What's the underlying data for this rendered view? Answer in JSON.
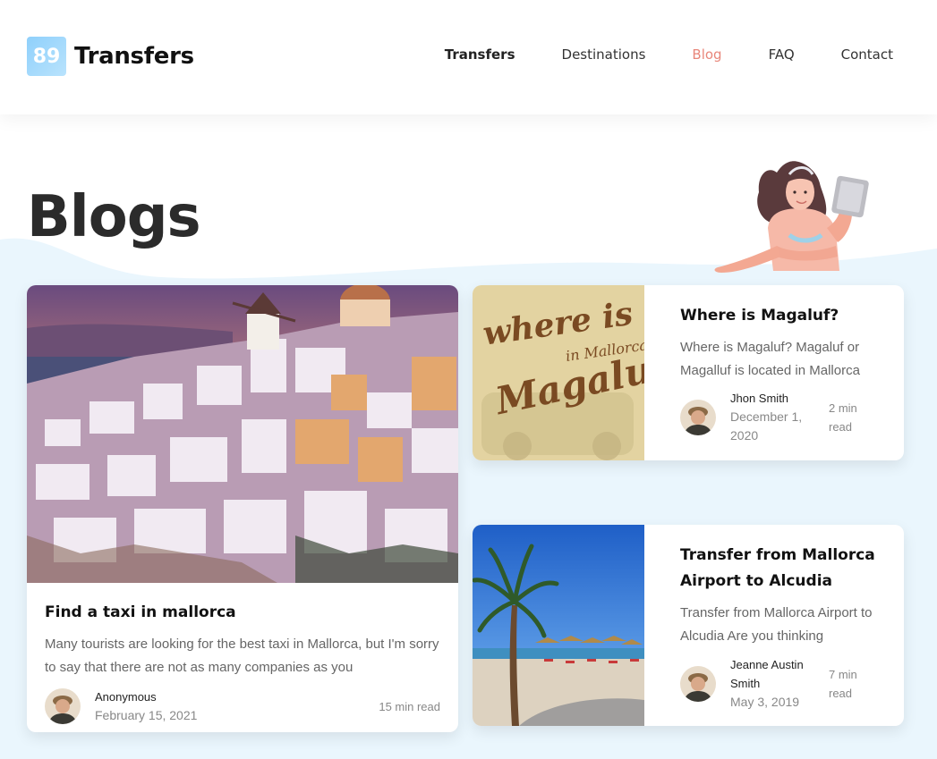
{
  "logo": {
    "badge": "89",
    "name": "Transfers"
  },
  "nav": [
    {
      "label": "Transfers"
    },
    {
      "label": "Destinations"
    },
    {
      "label": "Blog"
    },
    {
      "label": "FAQ"
    },
    {
      "label": "Contact"
    }
  ],
  "page": {
    "title": "Blogs"
  },
  "posts": [
    {
      "title": "Find a taxi in mallorca",
      "excerpt": "Many tourists are looking for the best taxi in Mallorca, but I'm sorry to say that there are not as many companies as you",
      "author": "Anonymous",
      "date": "February 15, 2021",
      "read_time": "15 min read"
    },
    {
      "title": "Where is Magaluf?",
      "excerpt": "Where is Magaluf? Magaluf or Magalluf is located in Mallorca",
      "author": "Jhon Smith",
      "date": "December 1, 2020",
      "read_time": "2 min read",
      "image_text": {
        "line1": "where is",
        "line2": "in Mallorca",
        "line3": "Magaluf"
      }
    },
    {
      "title": "Transfer from Mallorca Airport to Alcudia",
      "excerpt": "Transfer from Mallorca Airport to Alcudia Are you thinking",
      "author": "Jeanne Austin Smith",
      "date": "May 3, 2019",
      "read_time": "7 min read"
    }
  ],
  "colors": {
    "accent": "#e8867a",
    "hero_bg": "#eaf6fd",
    "logo": "#9dd7fb"
  }
}
